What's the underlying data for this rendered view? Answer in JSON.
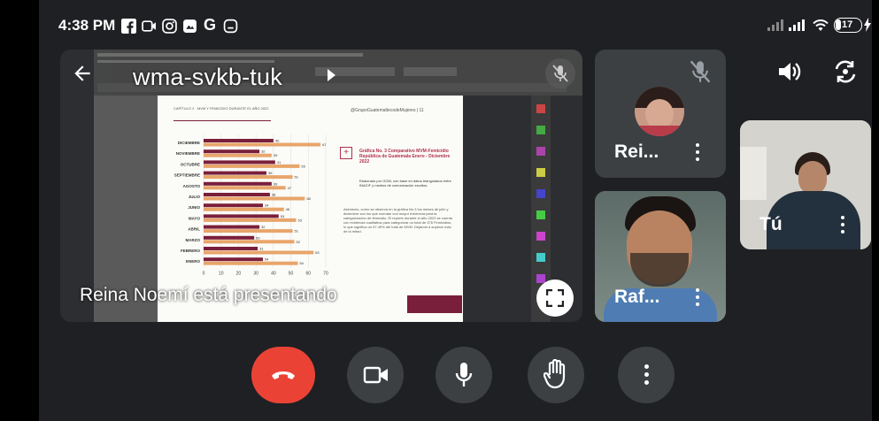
{
  "status_bar": {
    "time": "4:38 PM",
    "battery": "17"
  },
  "meeting": {
    "code": "wma-svkb-tuk",
    "presenting_text": "Reina Noemí está presentando"
  },
  "slide": {
    "header_left": "CAPÍTULO 2 · MVM Y FEMICIDIO DURANTE EL AÑO 2022",
    "header_right": "@GrupoGuatemaltecodeMujeres | 11",
    "caption_title": "Gráfica No. 3 Comparativo MVM-Femicidio República de Guatemala Enero - Diciembre 2022",
    "caption_note": "Elaborado por GGM, con base en datos triangulados entre INACIF y medios de comunicación escritos.",
    "caption_body": "Asimismo, como se observa en la gráfica No.3 los meses de julio y diciembre son los que cuentan con mayor evidencia para la categorización de femicidio. El reporte durante el año 2022 se cuenta con evidencia cualitativa para categorizar un total de 376 Femicidios, lo que significa un 57.49% del total de MVM. Dejando a superar más de la mitad.",
    "plus_label": "+"
  },
  "chart_data": {
    "type": "bar",
    "orientation": "horizontal",
    "categories": [
      "DICIEMBRE",
      "NOVIEMBRE",
      "OCTUBRE",
      "SEPTIEMBRE",
      "AGOSTO",
      "JULIO",
      "JUNIO",
      "MAYO",
      "ABRIL",
      "MARZO",
      "FEBRERO",
      "ENERO"
    ],
    "series": [
      {
        "color": "#7a1f3b",
        "values": [
          40,
          32,
          41,
          36,
          39,
          38,
          34,
          43,
          32,
          29,
          31,
          34
        ]
      },
      {
        "color": "#e8a56b",
        "values": [
          67,
          39,
          55,
          51,
          47,
          58,
          46,
          53,
          51,
          52,
          63,
          54
        ]
      }
    ],
    "bar_labels": [
      [
        "40",
        "67"
      ],
      [
        "32",
        "39"
      ],
      [
        "41",
        "55"
      ],
      [
        "36",
        "51"
      ],
      [
        "39",
        "47"
      ],
      [
        "38",
        "58"
      ],
      [
        "34",
        "46"
      ],
      [
        "53",
        "53"
      ],
      [
        "32",
        "51"
      ],
      [
        "50",
        "52"
      ],
      [
        "31",
        "63"
      ],
      [
        "54",
        "54"
      ]
    ],
    "xlim": [
      0,
      70
    ],
    "xticks": [
      "0",
      "10",
      "20",
      "30",
      "40",
      "50",
      "60",
      "70"
    ]
  },
  "participants": [
    {
      "name": "Rei...",
      "muted": true
    },
    {
      "name": "Raf...",
      "muted": false
    },
    {
      "name": "Tú",
      "muted": false
    }
  ],
  "controls": {
    "end_call": "end-call",
    "camera": "camera",
    "mic": "microphone",
    "raise_hand": "raise-hand",
    "more": "more-options"
  },
  "colors": {
    "end_call": "#ea4335",
    "button_bg": "#3c4043",
    "app_bg": "#1f2023",
    "accent_maroon": "#7a1f3b",
    "accent_orange": "#e8a56b"
  }
}
